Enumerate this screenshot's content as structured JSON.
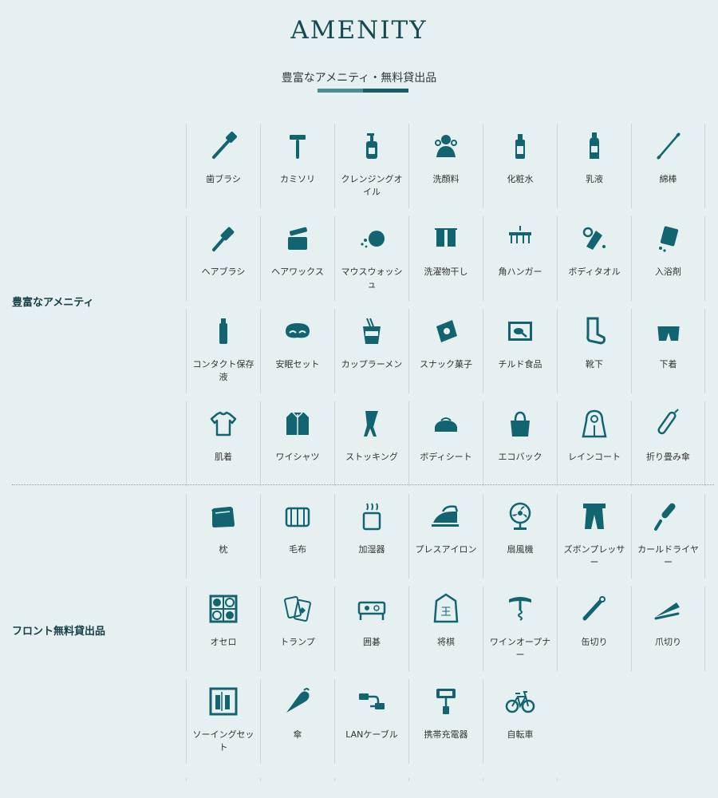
{
  "header": {
    "title": "AMENITY",
    "subtitle": "豊富なアメニティ・無料貸出品",
    "accent_light": "#4b8e97",
    "accent_dark": "#155e68"
  },
  "icon_color": "#126570",
  "sections": [
    {
      "label": "豊富なアメニティ",
      "items": [
        {
          "label": "歯ブラシ",
          "icon": "toothbrush-icon"
        },
        {
          "label": "カミソリ",
          "icon": "razor-icon"
        },
        {
          "label": "クレンジングオイル",
          "icon": "pump-bottle-icon"
        },
        {
          "label": "洗顔料",
          "icon": "face-wash-icon"
        },
        {
          "label": "化粧水",
          "icon": "lotion-bottle-icon"
        },
        {
          "label": "乳液",
          "icon": "milk-lotion-icon"
        },
        {
          "label": "綿棒",
          "icon": "cotton-swab-icon"
        },
        {
          "label": "ヘアブラシ",
          "icon": "hairbrush-icon"
        },
        {
          "label": "ヘアワックス",
          "icon": "hair-wax-icon"
        },
        {
          "label": "マウスウォッシュ",
          "icon": "mouthwash-icon"
        },
        {
          "label": "洗濯物干し",
          "icon": "laundry-icon"
        },
        {
          "label": "角ハンガー",
          "icon": "square-hanger-icon"
        },
        {
          "label": "ボディタオル",
          "icon": "body-towel-icon"
        },
        {
          "label": "入浴剤",
          "icon": "bath-salt-icon"
        },
        {
          "label": "コンタクト保存液",
          "icon": "contact-solution-icon"
        },
        {
          "label": "安眠セット",
          "icon": "eye-mask-icon"
        },
        {
          "label": "カップラーメン",
          "icon": "cup-noodle-icon"
        },
        {
          "label": "スナック菓子",
          "icon": "snack-icon"
        },
        {
          "label": "チルド食品",
          "icon": "chilled-food-icon"
        },
        {
          "label": "靴下",
          "icon": "sock-icon"
        },
        {
          "label": "下着",
          "icon": "underwear-icon"
        },
        {
          "label": "肌着",
          "icon": "tshirt-icon"
        },
        {
          "label": "ワイシャツ",
          "icon": "dress-shirt-icon"
        },
        {
          "label": "ストッキング",
          "icon": "stocking-icon"
        },
        {
          "label": "ボディシート",
          "icon": "body-sheet-icon"
        },
        {
          "label": "エコバック",
          "icon": "eco-bag-icon"
        },
        {
          "label": "レインコート",
          "icon": "raincoat-icon"
        },
        {
          "label": "折り畳み傘",
          "icon": "folding-umbrella-icon"
        }
      ]
    },
    {
      "label": "フロント無料貸出品",
      "items": [
        {
          "label": "枕",
          "icon": "pillow-icon"
        },
        {
          "label": "毛布",
          "icon": "blanket-icon"
        },
        {
          "label": "加湿器",
          "icon": "humidifier-icon"
        },
        {
          "label": "プレスアイロン",
          "icon": "iron-icon"
        },
        {
          "label": "扇風機",
          "icon": "fan-icon"
        },
        {
          "label": "ズボンプレッサー",
          "icon": "trouser-press-icon"
        },
        {
          "label": "カールドライヤー",
          "icon": "curling-iron-icon"
        },
        {
          "label": "オセロ",
          "icon": "othello-icon"
        },
        {
          "label": "トランプ",
          "icon": "playing-cards-icon"
        },
        {
          "label": "囲碁",
          "icon": "go-board-icon"
        },
        {
          "label": "将棋",
          "icon": "shogi-icon"
        },
        {
          "label": "ワインオープナー",
          "icon": "corkscrew-icon"
        },
        {
          "label": "缶切り",
          "icon": "can-opener-icon"
        },
        {
          "label": "爪切り",
          "icon": "nail-clipper-icon"
        },
        {
          "label": "ソーイングセット",
          "icon": "sewing-kit-icon"
        },
        {
          "label": "傘",
          "icon": "umbrella-icon"
        },
        {
          "label": "LANケーブル",
          "icon": "lan-cable-icon"
        },
        {
          "label": "携帯充電器",
          "icon": "phone-charger-icon"
        },
        {
          "label": "自転車",
          "icon": "bicycle-icon"
        }
      ]
    }
  ]
}
